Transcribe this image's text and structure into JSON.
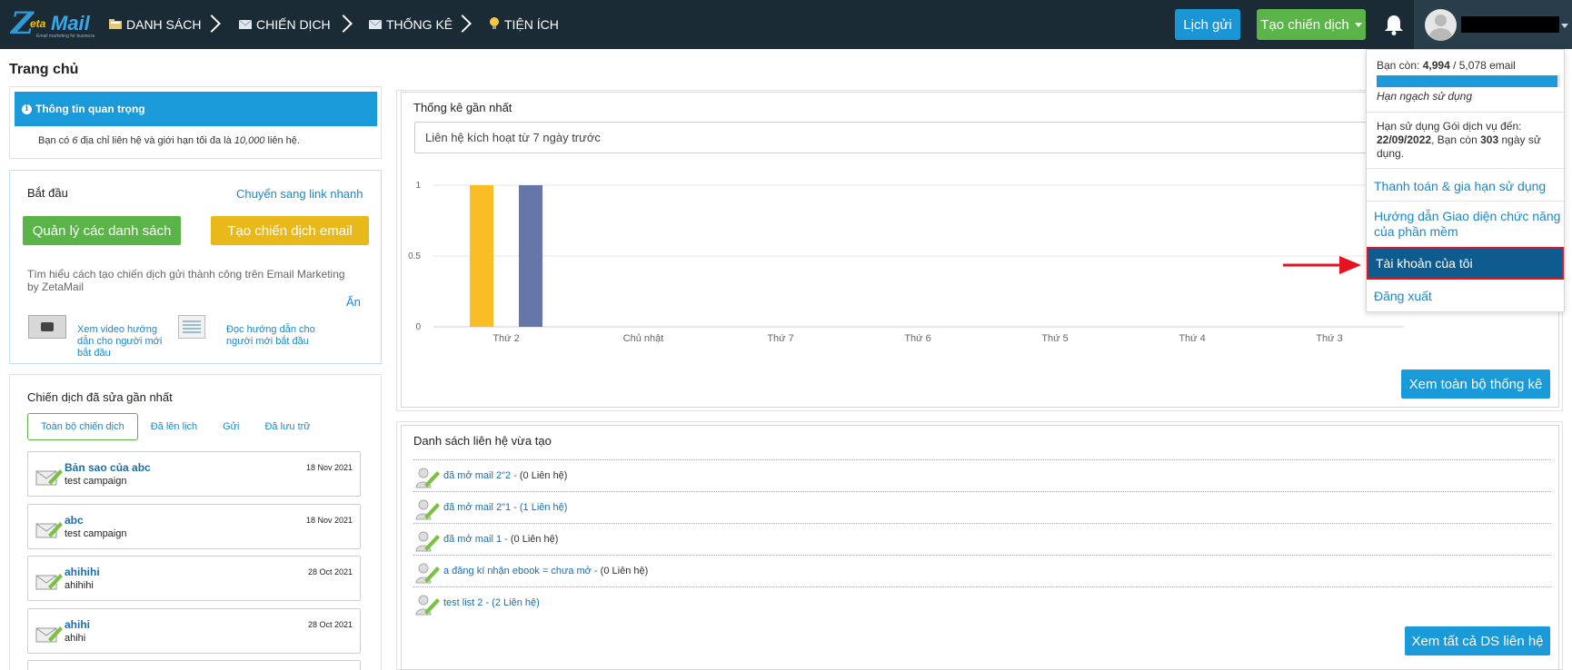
{
  "topbar": {
    "logo": {
      "z": "Z",
      "eta": "eta",
      "mail": "Mail",
      "tagline": "Email marketing for business"
    },
    "nav": [
      {
        "label": "DANH SÁCH",
        "icon": "folder-icon"
      },
      {
        "label": "CHIẾN DỊCH",
        "icon": "envelope-icon"
      },
      {
        "label": "THỐNG KÊ",
        "icon": "envelope-icon"
      },
      {
        "label": "TIỆN ÍCH",
        "icon": "lightbulb-icon"
      }
    ],
    "schedule_label": "Lịch gửi",
    "create_campaign_label": "Tạo chiến dịch"
  },
  "page_title": "Trang chủ",
  "important_info": {
    "title": "Thông tin quan trọng",
    "text_pre": "Bạn có",
    "contacts": "6",
    "text_mid": "địa chỉ liên hệ và giới hạn tối đa là",
    "limit": "10,000",
    "text_post": "liên hệ."
  },
  "start": {
    "title": "Bắt đầu",
    "quick_link": "Chuyển sang link nhanh",
    "manage_lists_label": "Quản lý các danh sách",
    "create_email_label": "Tạo chiến dịch email",
    "learn_text": "Tìm hiểu cách tạo chiến dịch gửi thành công trên Email Marketing by ZetaMail",
    "hide_label": "Ẩn",
    "video_guide": "Xem video hướng dẫn cho người mới bắt đầu",
    "doc_guide": "Đọc hướng dẫn cho người mới bắt đầu"
  },
  "campaigns": {
    "title": "Chiến dịch đã sửa gần nhất",
    "tabs": [
      "Toàn bộ chiến dịch",
      "Đã lên lịch",
      "Gửi",
      "Đã lưu trữ"
    ],
    "items": [
      {
        "name": "Bản sao của abc",
        "subject": "test campaign",
        "date": "18 Nov 2021"
      },
      {
        "name": "abc",
        "subject": "test campaign",
        "date": "18 Nov 2021"
      },
      {
        "name": "ahihihi",
        "subject": "ahihihi",
        "date": "28 Oct 2021"
      },
      {
        "name": "ahihi",
        "subject": "ahihi",
        "date": "28 Oct 2021"
      }
    ]
  },
  "stats": {
    "title": "Thống kê gần nhất",
    "select_value": "Liên hệ kích hoạt từ 7 ngày trước",
    "view_all_label": "Xem toàn bộ thống kê"
  },
  "chart_data": {
    "type": "bar",
    "categories": [
      "Thứ 2",
      "Chủ nhật",
      "Thứ 7",
      "Thứ 6",
      "Thứ 5",
      "Thứ 4",
      "Thứ 3"
    ],
    "series": [
      {
        "values": [
          1,
          0,
          0,
          0,
          0,
          0,
          0
        ],
        "color": "#fbbd26"
      },
      {
        "values": [
          1,
          0,
          0,
          0,
          0,
          0,
          0
        ],
        "color": "#6577a9"
      }
    ],
    "ylim": [
      0,
      1
    ],
    "yticks": [
      "0",
      "0.5",
      "1"
    ],
    "grid": true
  },
  "contact_lists": {
    "title": "Danh sách liên hệ vừa tạo",
    "items": [
      {
        "name": "đã mở mail 2\"2 -",
        "count": "(0 Liên hệ)"
      },
      {
        "name": "đã mở mail 2\"1 - (1 Liên hệ)",
        "count": ""
      },
      {
        "name": "đã mở mail 1 -",
        "count": "(0 Liên hệ)"
      },
      {
        "name": "a đăng kí nhận ebook = chưa mở -",
        "count": "(0 Liên hệ)"
      },
      {
        "name": "test list 2 - (2 Liên hệ)",
        "count": ""
      }
    ],
    "view_all_label": "Xem tất cả DS liên hệ"
  },
  "account_menu": {
    "quota_prefix": "Bạn còn:",
    "quota_remaining": "4,994",
    "quota_total": "/ 5,078 email",
    "quota_fraction": 0.983,
    "quota_label": "Hạn ngạch sử dụng",
    "expiry_prefix": "Hạn sử dụng Gói dịch vụ đến:",
    "expiry_date": "22/09/2022",
    "expiry_mid": ", Bạn còn",
    "expiry_days": "303",
    "expiry_suffix": "ngày sử dụng.",
    "items": [
      {
        "label": "Thanh toán & gia hạn sử dụng"
      },
      {
        "label": "Hướng dẫn Giao diện chức năng của phần mềm"
      },
      {
        "label": "Tài khoản của tôi"
      },
      {
        "label": "Đăng xuất"
      }
    ]
  },
  "colors": {
    "topbar": "#1b2b36",
    "accent_blue": "#1a9ad9",
    "green": "#5ab447",
    "yellow": "#e9b91c",
    "highlight": "#e5131f"
  }
}
